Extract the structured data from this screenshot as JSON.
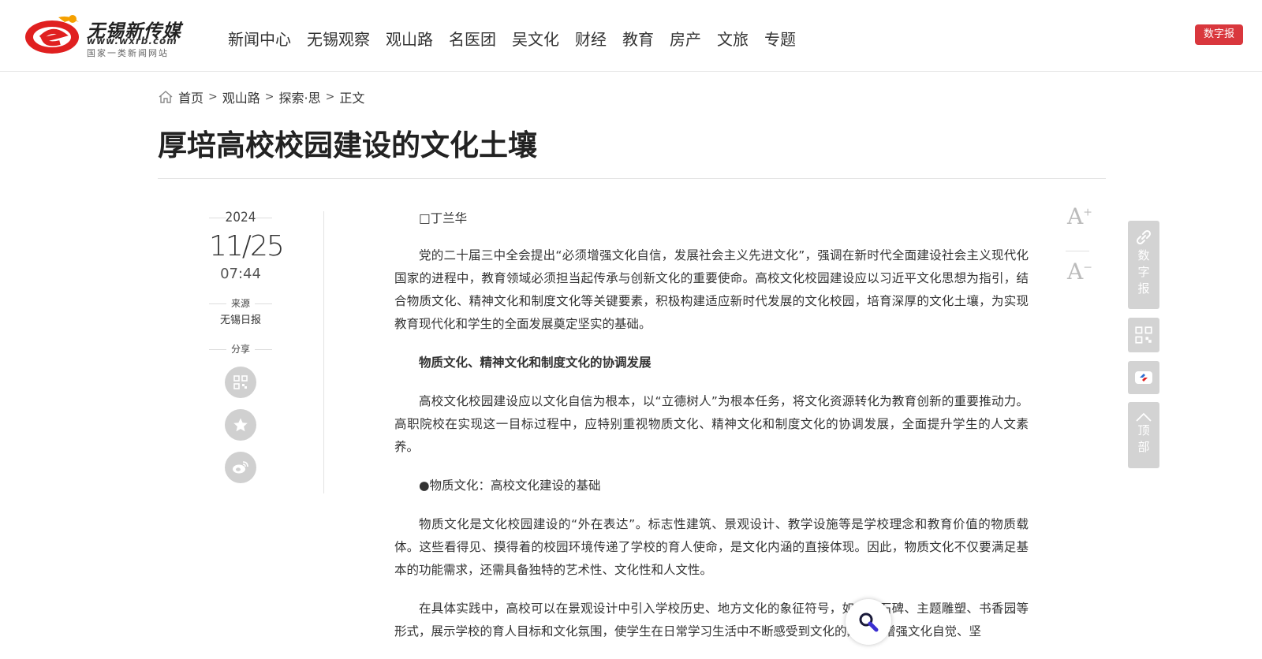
{
  "header": {
    "logo": {
      "brand": "无锡新传媒",
      "url": "www.wxrb.com",
      "slogan": "国家一类新闻网站"
    },
    "nav": [
      "新闻中心",
      "无锡观察",
      "观山路",
      "名医团",
      "吴文化",
      "财经",
      "教育",
      "房产",
      "文旅",
      "专题"
    ],
    "digital_label": "数字报"
  },
  "breadcrumb": {
    "home": "首页",
    "items": [
      "观山路",
      "探索·思",
      "正文"
    ],
    "separator": ">"
  },
  "article": {
    "title": "厚培高校校园建设的文化土壤",
    "year": "2024",
    "month_day": "11/25",
    "time": "07:44",
    "source_label": "来源",
    "source": "无锡日报",
    "share_label": "分享",
    "author": "□丁兰华",
    "paragraphs": [
      "党的二十届三中全会提出“必须增强文化自信，发展社会主义先进文化”，强调在新时代全面建设社会主义现代化国家的进程中，教育领域必须担当起传承与创新文化的重要使命。高校文化校园建设应以习近平文化思想为指引，结合物质文化、精神文化和制度文化等关键要素，积极构建适应新时代发展的文化校园，培育深厚的文化土壤，为实现教育现代化和学生的全面发展奠定坚实的基础。",
      "物质文化、精神文化和制度文化的协调发展",
      "高校文化校园建设应以文化自信为根本，以“立德树人”为根本任务，将文化资源转化为教育创新的重要推动力。高职院校在实现这一目标过程中，应特别重视物质文化、精神文化和制度文化的协调发展，全面提升学生的人文素养。",
      "●物质文化：高校文化建设的基础",
      "物质文化是文化校园建设的“外在表达”。标志性建筑、景观设计、教学设施等是学校理念和教育价值的物质载体。这些看得见、摸得着的校园环境传递了学校的育人使命，是文化内涵的直接体现。因此，物质文化不仅要满足基本的功能需求，还需具备独特的艺术性、文化性和人文性。",
      "在具体实践中，高校可以在景观设计中引入学校历史、地方文化的象征符号，如文化石碑、主题雕塑、书香园等形式，展示学校的育人目标和文化氛围，使学生在日常学习生活中不断感受到文化的熏陶，增强文化自觉、坚"
    ]
  },
  "font_controls": {
    "increase": "A+",
    "decrease": "A−"
  },
  "float_bar": {
    "digital_label": [
      "数",
      "字",
      "报"
    ],
    "top_label": [
      "顶",
      "部"
    ]
  },
  "colors": {
    "accent": "#d9373d",
    "logo_red": "#e02020",
    "logo_orange": "#f5a000"
  },
  "icons": [
    "home-icon",
    "qrcode-icon",
    "star-icon",
    "weibo-icon",
    "link-icon",
    "app-icon",
    "up-arrow-icon",
    "magnifier-icon"
  ]
}
